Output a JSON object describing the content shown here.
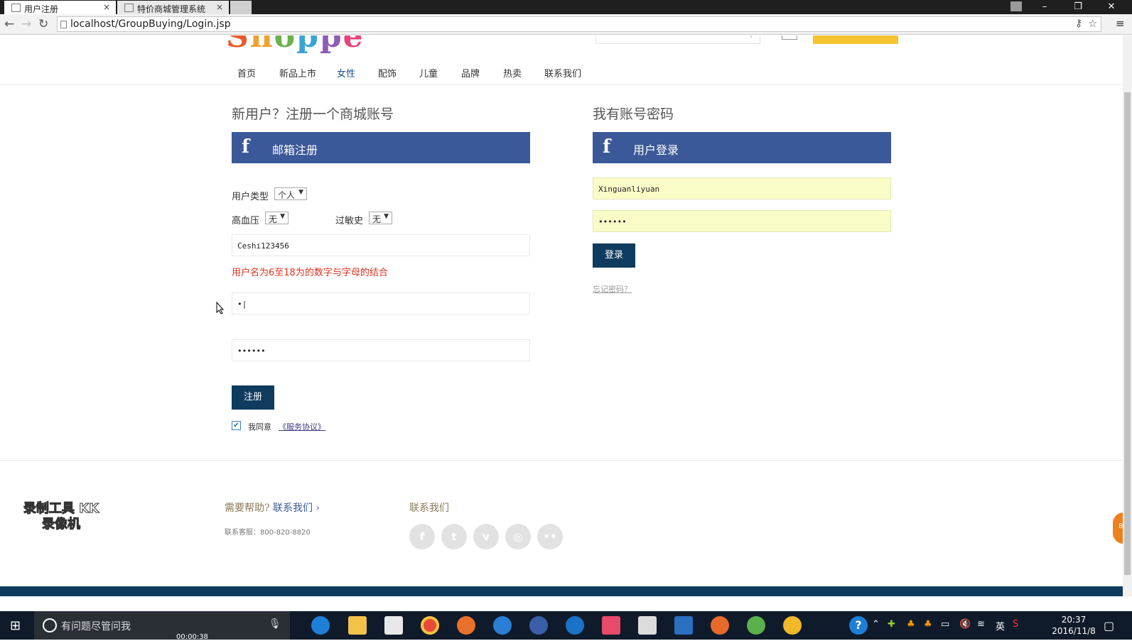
{
  "browser": {
    "tabs": [
      {
        "title": "用户注册",
        "active": true
      },
      {
        "title": "特价商城管理系统",
        "active": false
      }
    ],
    "close_glyph": "×",
    "url": "localhost/GroupBuying/Login.jsp"
  },
  "site": {
    "logo_text": "Shoppe",
    "logo_colors": [
      "#e85a2c",
      "#f0a030",
      "#6ab04c",
      "#3ba3d8",
      "#8e5bb5",
      "#e8437a"
    ],
    "nav": [
      "首页",
      "新品上市",
      "女性",
      "配饰",
      "儿童",
      "品牌",
      "热卖",
      "联系我们"
    ],
    "nav_active_index": 2
  },
  "register": {
    "title": "新用户？注册一个商城账号",
    "header": "邮箱注册",
    "user_type_label": "用户类型",
    "user_type_value": "个人",
    "hypertension_label": "高血压",
    "hypertension_value": "无",
    "allergy_label": "过敏史",
    "allergy_value": "无",
    "username_value": "Ceshi123456",
    "username_error": "用户名为6至18为的数字与字母的结合",
    "password_value": "•|",
    "confirm_password_value": "••••••",
    "submit_label": "注册",
    "agree_checked": true,
    "agree_label": "我同意",
    "agreement_link": "《服务协议》"
  },
  "login": {
    "title": "我有账号密码",
    "header": "用户登录",
    "username_value": "Xinguanliyuan",
    "password_value": "••••••",
    "submit_label": "登录",
    "forgot_link": "忘记密码？"
  },
  "footer": {
    "help_title": "需要帮助?",
    "help_link": "联系我们",
    "service_phone": "联系客服：800-820-8820",
    "contact_title": "联系我们",
    "social_icons": [
      "facebook-icon",
      "twitter-icon",
      "vimeo-icon",
      "dribbble-icon",
      "flickr-icon"
    ],
    "social_glyphs": [
      "f",
      "t",
      "v",
      "◎",
      "••"
    ],
    "watermark": "录制工具 KK录像机",
    "float_badge": "81"
  },
  "taskbar": {
    "search_placeholder": "有问题尽管问我",
    "recording_timer": "00:00:38",
    "ime_label": "英",
    "clock_time": "20:37",
    "clock_date": "2016/11/8"
  },
  "colors": {
    "facebook_blue": "#3b5998",
    "button_navy": "#0e3b5e",
    "error_red": "#e0301e",
    "autofill_yellow": "#fafcc8"
  }
}
